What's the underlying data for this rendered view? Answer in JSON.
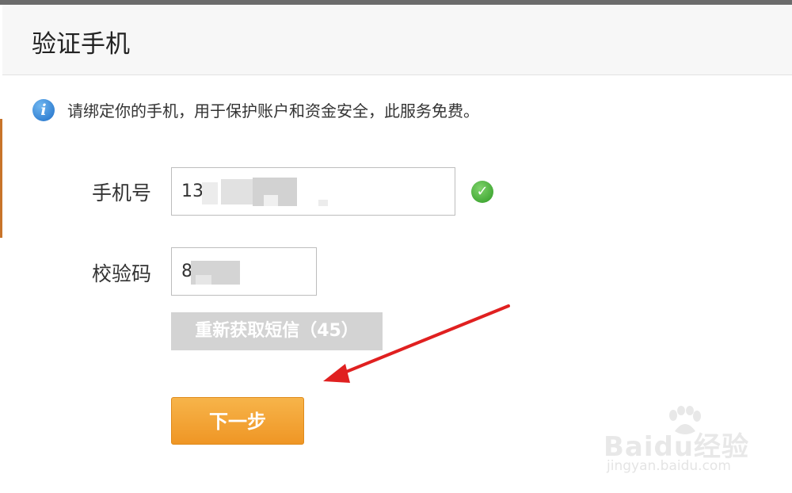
{
  "dialog": {
    "title": "验证手机",
    "notice": "请绑定你的手机，用于保护账户和资金安全，此服务免费。"
  },
  "form": {
    "phone_label": "手机号",
    "phone_value": "13",
    "code_label": "校验码",
    "code_value": "8",
    "resend_label": "重新获取短信（45）",
    "next_label": "下一步"
  },
  "icons": {
    "info": "info-icon",
    "valid": "check-circle-icon"
  },
  "watermark": {
    "brand": "Baidu经验",
    "url": "jingyan.baidu.com"
  },
  "colors": {
    "primary_button": "#f0a033",
    "disabled_button": "#d3d3d3",
    "success": "#2e9a23",
    "info": "#1f6fc8",
    "annotation_arrow": "#e02020"
  }
}
